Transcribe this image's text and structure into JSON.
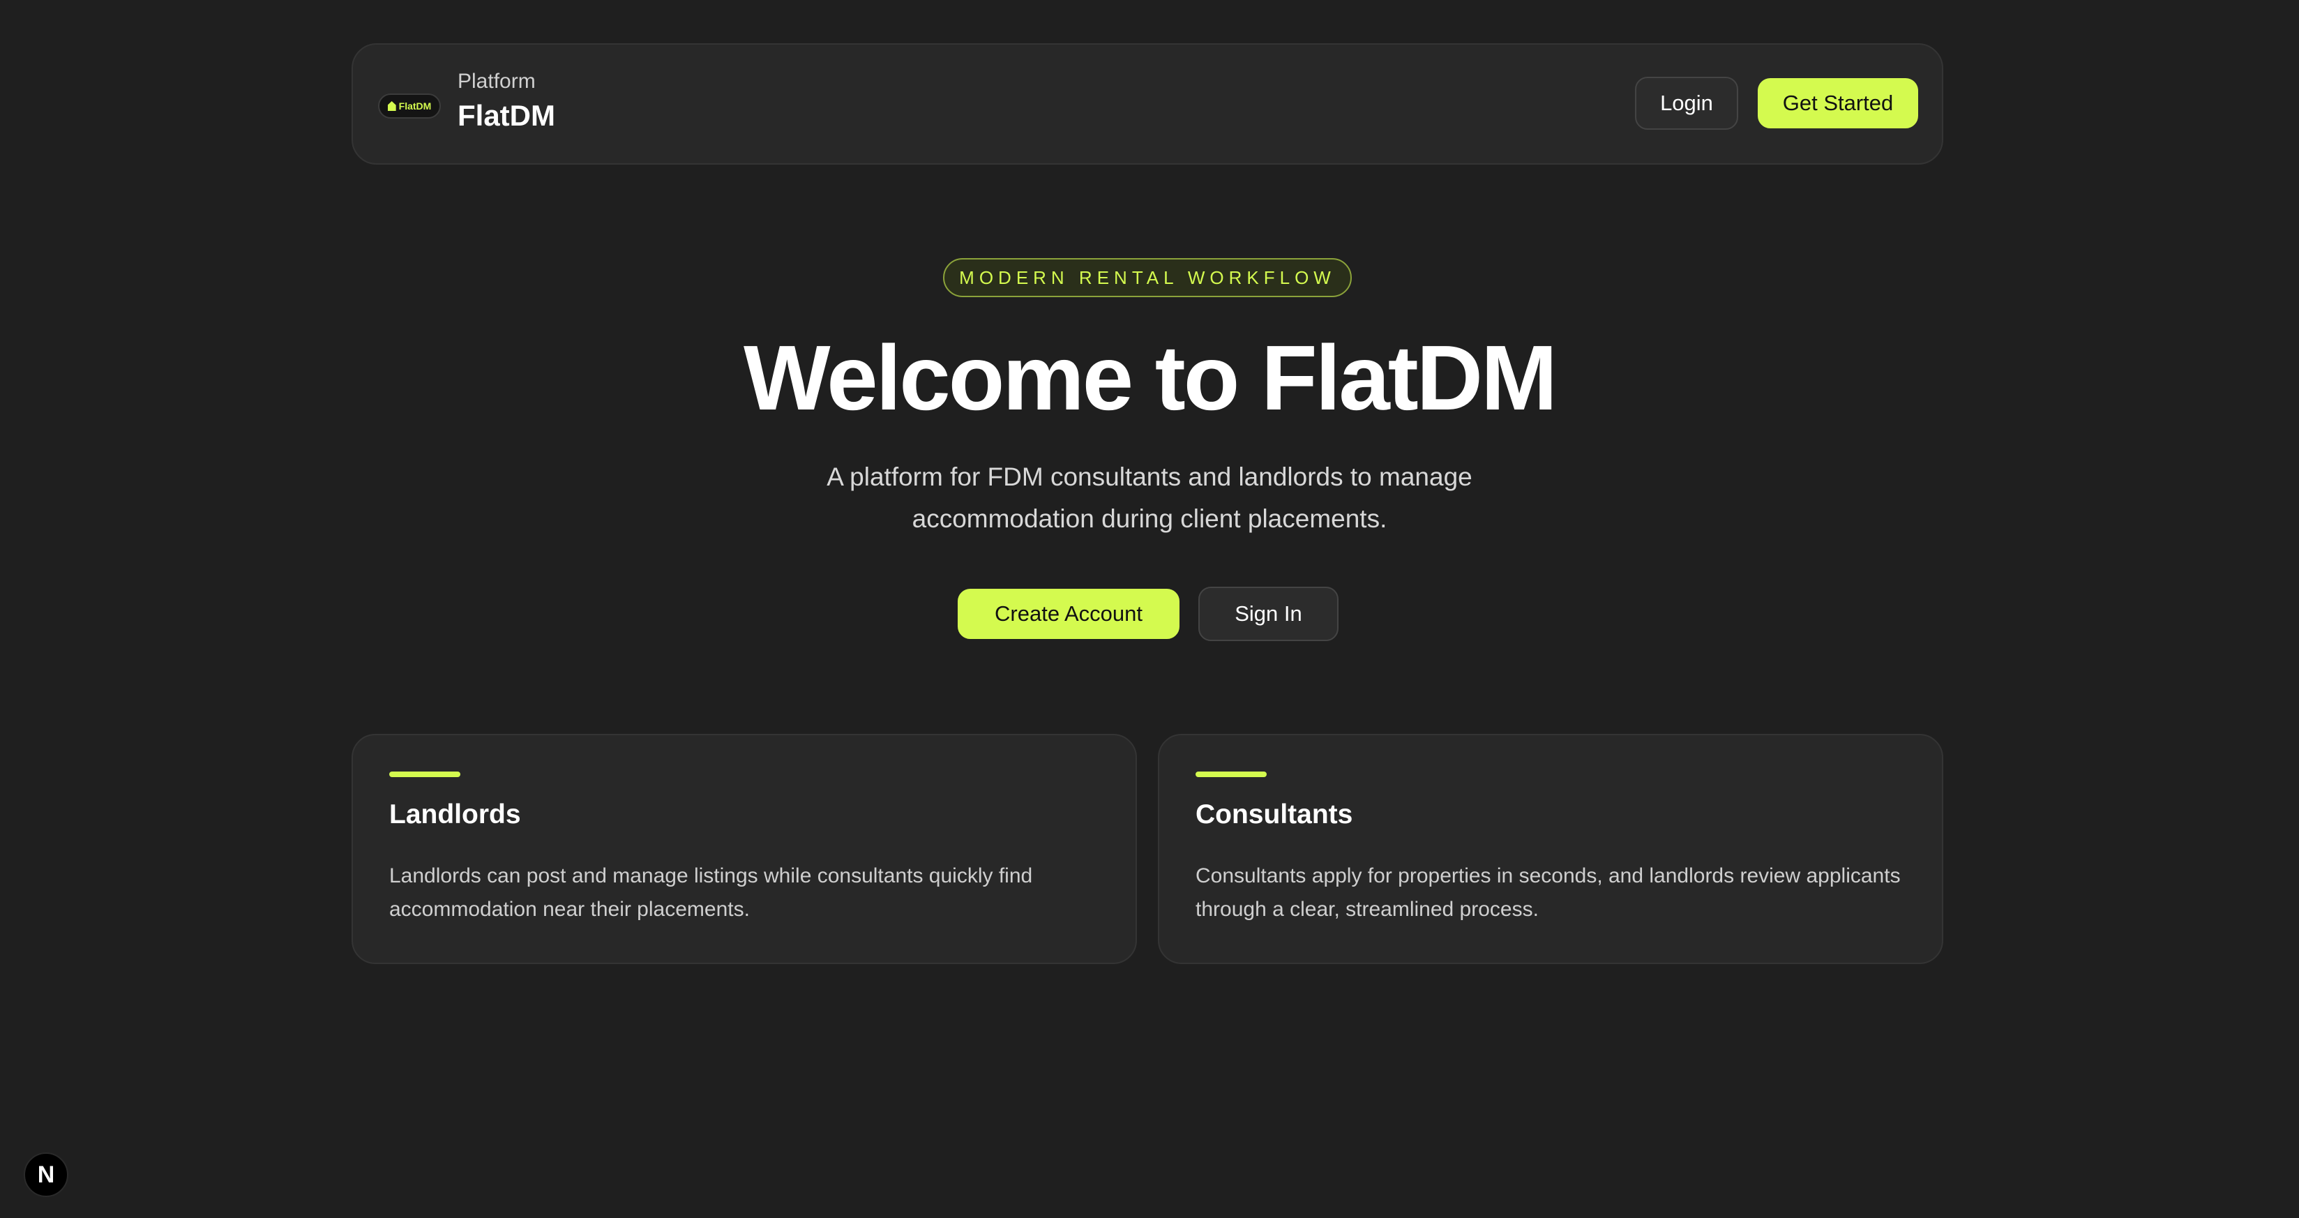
{
  "colors": {
    "background": "#1f1f1f",
    "surface": "#282828",
    "accent": "#d4fa4f",
    "text": "#ffffff",
    "muted": "#cfcfcf"
  },
  "header": {
    "logo_text": "FlatDM",
    "logo_icon": "house-icon",
    "kicker": "Platform",
    "brand": "FlatDM",
    "login_label": "Login",
    "get_started_label": "Get Started"
  },
  "hero": {
    "badge": "MODERN RENTAL WORKFLOW",
    "title": "Welcome to FlatDM",
    "subtitle": "A platform for FDM consultants and landlords to manage accommodation during client placements.",
    "create_account_label": "Create Account",
    "sign_in_label": "Sign In"
  },
  "cards": [
    {
      "title": "Landlords",
      "text": "Landlords can post and manage listings while consultants quickly find accommodation near their placements."
    },
    {
      "title": "Consultants",
      "text": "Consultants apply for properties in seconds, and landlords review applicants through a clear, streamlined process."
    }
  ],
  "dev_badge": {
    "letter": "N",
    "icon": "nextjs-icon"
  }
}
